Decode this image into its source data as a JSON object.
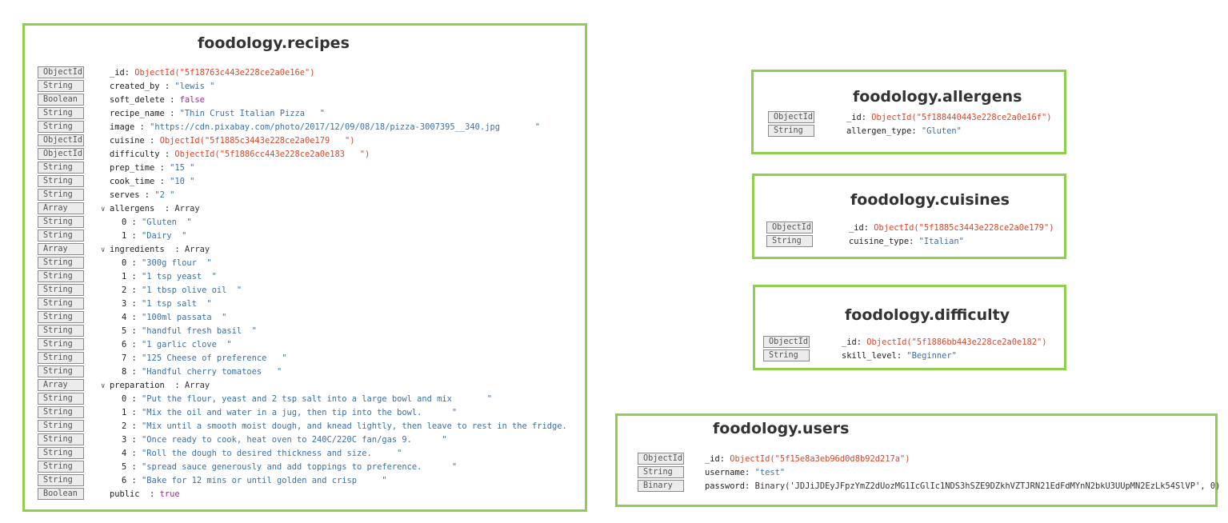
{
  "recipes": {
    "title": "foodology.recipes",
    "fields": [
      {
        "type": "ObjectId",
        "key": "_id",
        "sep": ": ",
        "value": "ObjectId(\"5f18763c443e228ce2a0e16e\")",
        "vclass": "oid"
      },
      {
        "type": "String",
        "key": "created_by",
        "sep": " : ",
        "value": "\"lewis \"",
        "vclass": "str"
      },
      {
        "type": "Boolean",
        "key": "soft_delete",
        "sep": " : ",
        "value": "false",
        "vclass": "bool"
      },
      {
        "type": "String",
        "key": "recipe_name",
        "sep": " : ",
        "value": "\"Thin Crust Italian Pizza   \"",
        "vclass": "str"
      },
      {
        "type": "String",
        "key": "image",
        "sep": " : ",
        "value": "\"https://cdn.pixabay.com/photo/2017/12/09/08/18/pizza-3007395__340.jpg       \"",
        "vclass": "str"
      },
      {
        "type": "ObjectId",
        "key": "cuisine",
        "sep": " : ",
        "value": "ObjectId(\"5f1885c3443e228ce2a0e179   \")",
        "vclass": "oid"
      },
      {
        "type": "ObjectId",
        "key": "difficulty",
        "sep": " : ",
        "value": "ObjectId(\"5f1886cc443e228ce2a0e183   \")",
        "vclass": "oid"
      },
      {
        "type": "String",
        "key": "prep_time",
        "sep": " : ",
        "value": "\"15 \"",
        "vclass": "str"
      },
      {
        "type": "String",
        "key": "cook_time",
        "sep": " : ",
        "value": "\"10 \"",
        "vclass": "str"
      },
      {
        "type": "String",
        "key": "serves",
        "sep": " : ",
        "value": "\"2 \"",
        "vclass": "str"
      },
      {
        "type": "Array",
        "key": "allergens",
        "sep": "  : ",
        "value": "Array",
        "vclass": "plain",
        "expand": true
      },
      {
        "type": "String",
        "key": "0",
        "sep": " : ",
        "value": "\"Gluten  \"",
        "vclass": "str",
        "indent": true
      },
      {
        "type": "String",
        "key": "1",
        "sep": " : ",
        "value": "\"Dairy  \"",
        "vclass": "str",
        "indent": true
      },
      {
        "type": "Array",
        "key": "ingredients",
        "sep": "  : ",
        "value": "Array",
        "vclass": "plain",
        "expand": true
      },
      {
        "type": "String",
        "key": "0",
        "sep": " : ",
        "value": "\"300g flour  \"",
        "vclass": "str",
        "indent": true
      },
      {
        "type": "String",
        "key": "1",
        "sep": " : ",
        "value": "\"1 tsp yeast  \"",
        "vclass": "str",
        "indent": true
      },
      {
        "type": "String",
        "key": "2",
        "sep": " : ",
        "value": "\"1 tbsp olive oil  \"",
        "vclass": "str",
        "indent": true
      },
      {
        "type": "String",
        "key": "3",
        "sep": " : ",
        "value": "\"1 tsp salt  \"",
        "vclass": "str",
        "indent": true
      },
      {
        "type": "String",
        "key": "4",
        "sep": " : ",
        "value": "\"100ml passata  \"",
        "vclass": "str",
        "indent": true
      },
      {
        "type": "String",
        "key": "5",
        "sep": " : ",
        "value": "\"handful fresh basil  \"",
        "vclass": "str",
        "indent": true
      },
      {
        "type": "String",
        "key": "6",
        "sep": " : ",
        "value": "\"1 garlic clove  \"",
        "vclass": "str",
        "indent": true
      },
      {
        "type": "String",
        "key": "7",
        "sep": " : ",
        "value": "\"125 Cheese of preference   \"",
        "vclass": "str",
        "indent": true
      },
      {
        "type": "String",
        "key": "8",
        "sep": " : ",
        "value": "\"Handful cherry tomatoes   \"",
        "vclass": "str",
        "indent": true
      },
      {
        "type": "Array",
        "key": "preparation",
        "sep": "  : ",
        "value": "Array",
        "vclass": "plain",
        "expand": true
      },
      {
        "type": "String",
        "key": "0",
        "sep": " : ",
        "value": "\"Put the flour, yeast and 2 tsp salt into a large bowl and mix       \"",
        "vclass": "str",
        "indent": true
      },
      {
        "type": "String",
        "key": "1",
        "sep": " : ",
        "value": "\"Mix the oil and water in a jug, then tip into the bowl.      \"",
        "vclass": "str",
        "indent": true
      },
      {
        "type": "String",
        "key": "2",
        "sep": " : ",
        "value": "\"Mix until a smooth moist dough, and knead lightly, then leave to rest in the fridge.",
        "vclass": "str",
        "indent": true
      },
      {
        "type": "String",
        "key": "3",
        "sep": " : ",
        "value": "\"Once ready to cook, heat oven to 240C/220C fan/gas 9.      \"",
        "vclass": "str",
        "indent": true
      },
      {
        "type": "String",
        "key": "4",
        "sep": " : ",
        "value": "\"Roll the dough to desired thickness and size.     \"",
        "vclass": "str",
        "indent": true
      },
      {
        "type": "String",
        "key": "5",
        "sep": " : ",
        "value": "\"spread sauce generously and add toppings to preference.      \"",
        "vclass": "str",
        "indent": true
      },
      {
        "type": "String",
        "key": "6",
        "sep": " : ",
        "value": "\"Bake for 12 mins or until golden and crisp     \"",
        "vclass": "str",
        "indent": true
      },
      {
        "type": "Boolean",
        "key": "public",
        "sep": "  : ",
        "value": "true",
        "vclass": "bool"
      }
    ]
  },
  "allergens": {
    "title": "foodology.allergens",
    "fields": [
      {
        "type": "ObjectId",
        "key": "_id",
        "sep": ": ",
        "value": "ObjectId(\"5f188440443e228ce2a0e16f\")",
        "vclass": "oid"
      },
      {
        "type": "String",
        "key": "allergen_type",
        "sep": ": ",
        "value": "\"Gluten\"",
        "vclass": "str"
      }
    ]
  },
  "cuisines": {
    "title": "foodology.cuisines",
    "fields": [
      {
        "type": "ObjectId",
        "key": "_id",
        "sep": ": ",
        "value": "ObjectId(\"5f1885c3443e228ce2a0e179\")",
        "vclass": "oid"
      },
      {
        "type": "String",
        "key": "cuisine_type",
        "sep": ": ",
        "value": "\"Italian\"",
        "vclass": "str"
      }
    ]
  },
  "difficulty": {
    "title": "foodology.difficulty",
    "fields": [
      {
        "type": "ObjectId",
        "key": "_id",
        "sep": ": ",
        "value": "ObjectId(\"5f1886bb443e228ce2a0e182\")",
        "vclass": "oid"
      },
      {
        "type": "String",
        "key": "skill_level",
        "sep": ": ",
        "value": "\"Beginner\"",
        "vclass": "str"
      }
    ]
  },
  "users": {
    "title": "foodology.users",
    "fields": [
      {
        "type": "ObjectId",
        "key": "_id",
        "sep": ": ",
        "value": "ObjectId(\"5f15e8a3eb96d0d8b92d217a\")",
        "vclass": "oid"
      },
      {
        "type": "String",
        "key": "username",
        "sep": ": ",
        "value": "\"test\"",
        "vclass": "str"
      },
      {
        "type": "Binary",
        "key": "password",
        "sep": ": ",
        "value": "Binary('JDJiJDEyJFpzYmZ2dUozMG1IcGlIc1NDS3hSZE9DZkhVZTJRN21EdFdMYnN2bkU3UUpMN2EzLk54SlVP', 0)",
        "vclass": "plain"
      }
    ]
  }
}
